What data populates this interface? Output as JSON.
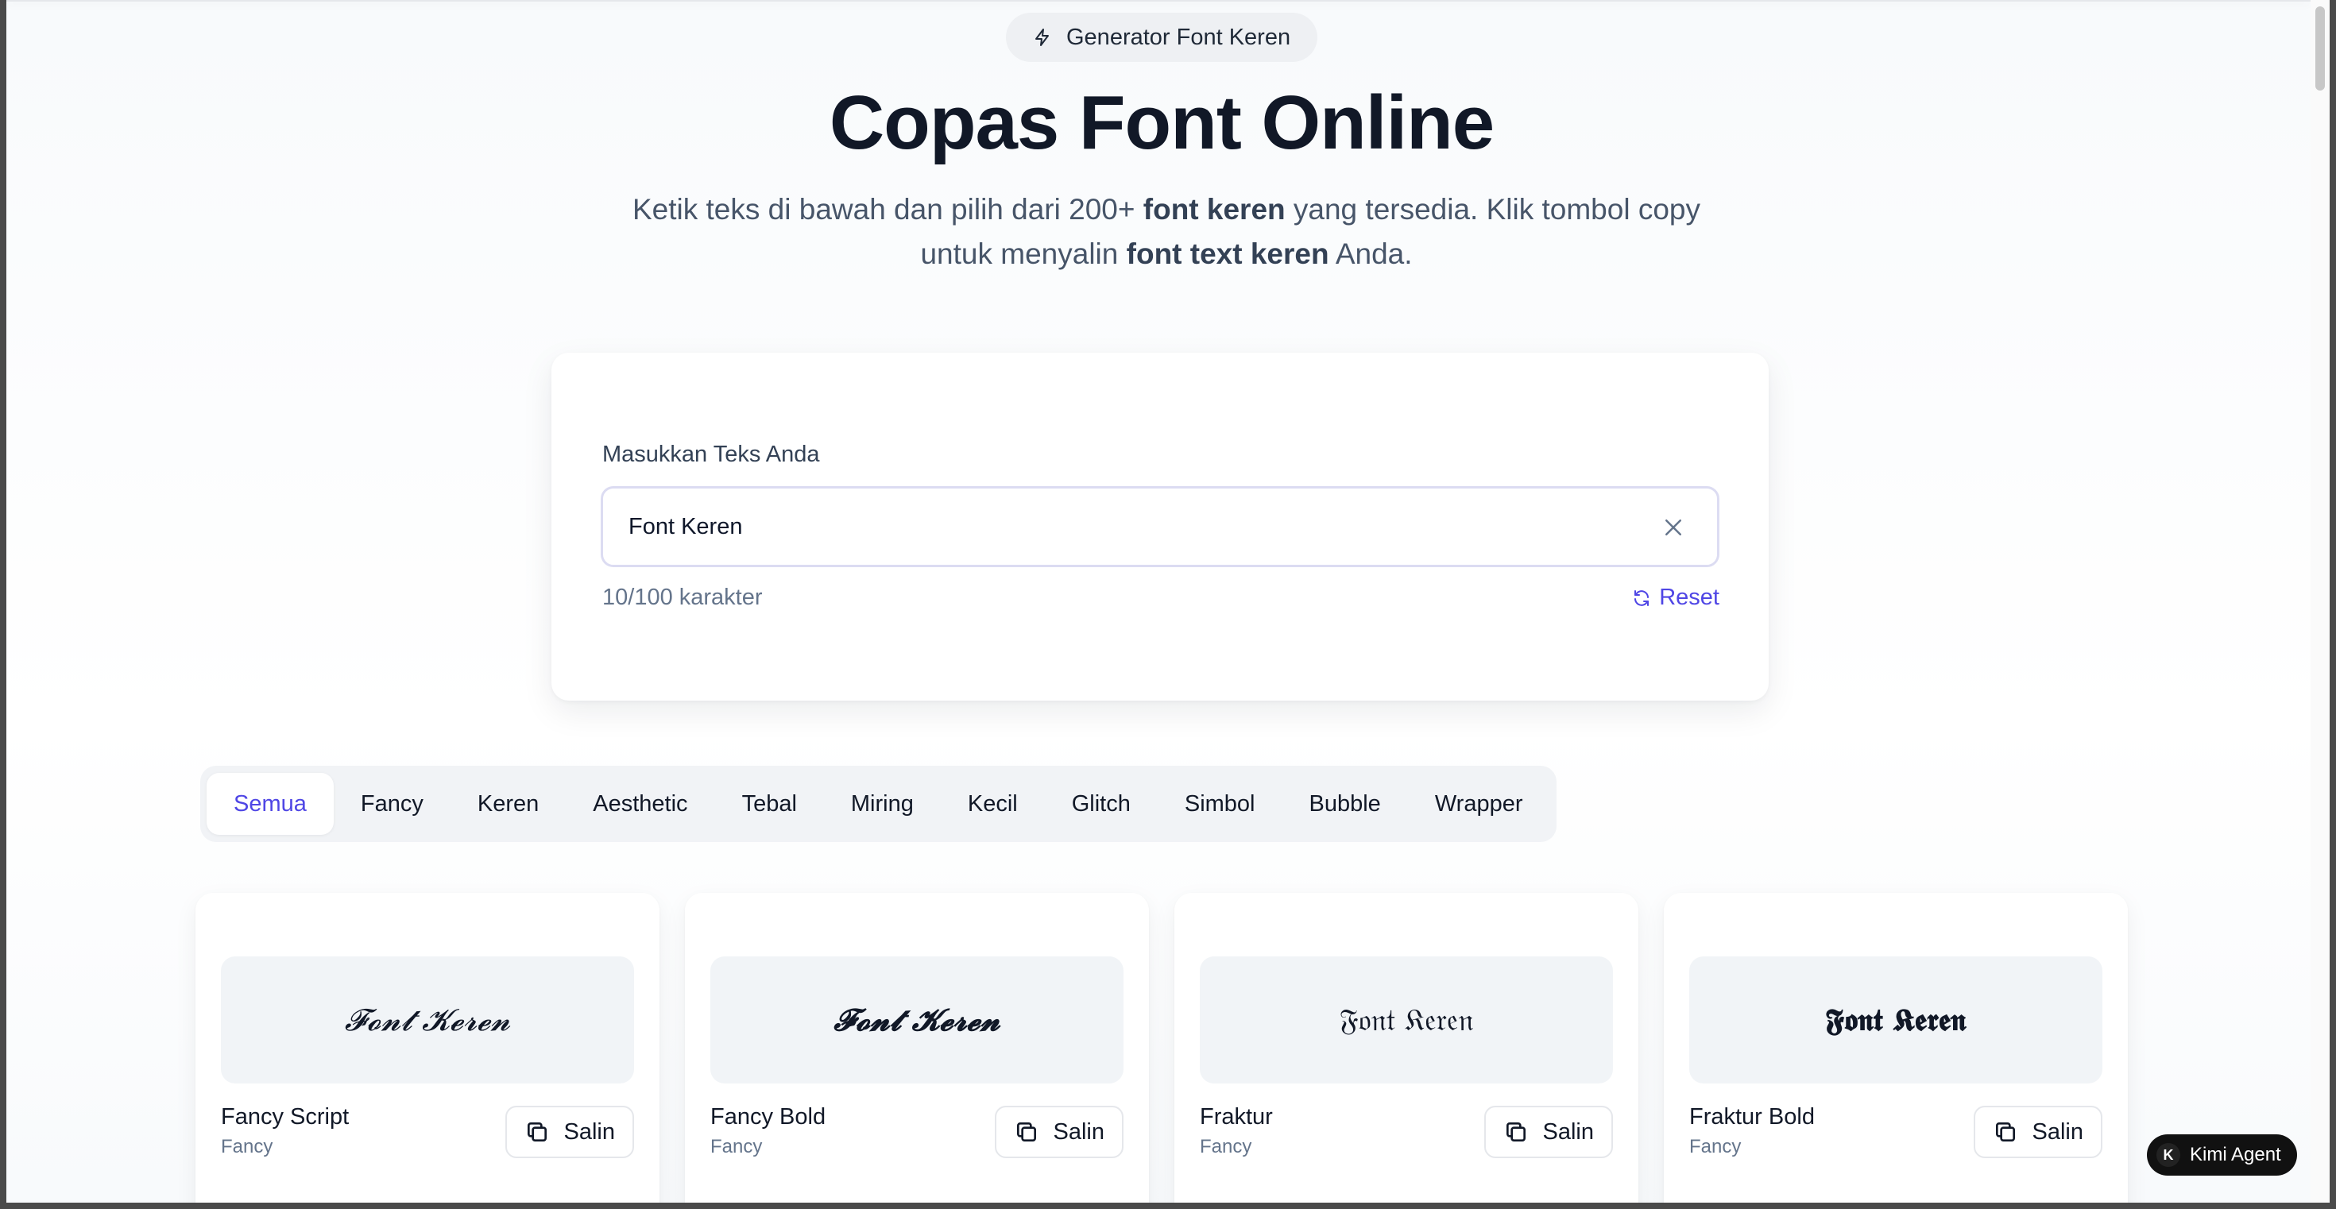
{
  "badge": {
    "icon": "zap-icon",
    "label": "Generator Font Keren"
  },
  "hero": {
    "title": "Copas Font Online",
    "sub_line1_pre": "Ketik teks di bawah dan pilih dari 200+ ",
    "sub_line1_bold": "font keren",
    "sub_line1_post": " yang tersedia. Klik tombol copy",
    "sub_line2_pre": "untuk menyalin ",
    "sub_line2_bold": "font text keren",
    "sub_line2_post": " Anda."
  },
  "input_card": {
    "label": "Masukkan Teks Anda",
    "value": "Font Keren",
    "counter": "10/100 karakter",
    "reset_label": "Reset"
  },
  "tabs": [
    {
      "label": "Semua",
      "active": true
    },
    {
      "label": "Fancy"
    },
    {
      "label": "Keren"
    },
    {
      "label": "Aesthetic"
    },
    {
      "label": "Tebal"
    },
    {
      "label": "Miring"
    },
    {
      "label": "Kecil"
    },
    {
      "label": "Glitch"
    },
    {
      "label": "Simbol"
    },
    {
      "label": "Bubble"
    },
    {
      "label": "Wrapper"
    }
  ],
  "font_cards": [
    {
      "preview": "𝓕𝓸𝓷𝓽 𝓚𝓮𝓻𝓮𝓷",
      "name": "Fancy Script",
      "category": "Fancy",
      "copy_label": "Salin"
    },
    {
      "preview": "𝓕𝓸𝓷𝓽 𝓚𝓮𝓻𝓮𝓷",
      "name": "Fancy Bold",
      "category": "Fancy",
      "copy_label": "Salin"
    },
    {
      "preview": "𝔉𝔬𝔫𝔱 𝔎𝔢𝔯𝔢𝔫",
      "name": "Fraktur",
      "category": "Fancy",
      "copy_label": "Salin"
    },
    {
      "preview": "𝕱𝖔𝖓𝖙 𝕶𝖊𝖗𝖊𝖓",
      "name": "Fraktur Bold",
      "category": "Fancy",
      "copy_label": "Salin"
    }
  ],
  "kimi": {
    "label": "Kimi Agent",
    "logo": "K"
  },
  "colors": {
    "accent": "#4f46e5",
    "title": "#111827",
    "muted": "#64748b"
  }
}
